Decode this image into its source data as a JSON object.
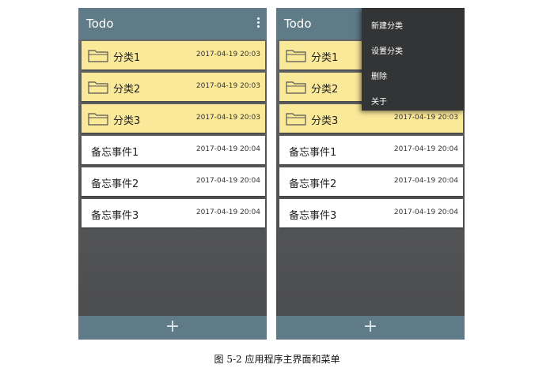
{
  "appbar": {
    "title": "Todo",
    "more_icon": "overflow-menu-icon"
  },
  "categories": [
    {
      "label": "分类1",
      "date": "2017-04-19",
      "time": "20:03"
    },
    {
      "label": "分类2",
      "date": "2017-04-19",
      "time": "20:03"
    },
    {
      "label": "分类3",
      "date": "2017-04-19",
      "time": "20:03"
    }
  ],
  "memos": [
    {
      "label": "备忘事件1",
      "date": "2017-04-19",
      "time": "20:04"
    },
    {
      "label": "备忘事件2",
      "date": "2017-04-19",
      "time": "20:04"
    },
    {
      "label": "备忘事件3",
      "date": "2017-04-19",
      "time": "20:04"
    }
  ],
  "bottombar": {
    "add_label": "+"
  },
  "menu": {
    "items": [
      "新建分类",
      "设置分类",
      "删除",
      "关于"
    ]
  },
  "caption": "图 5-2  应用程序主界面和菜单",
  "colors": {
    "appbar": "#5f7b87",
    "category_bg": "#fbe99a",
    "memo_bg": "#ffffff",
    "menu_bg": "#333435"
  }
}
